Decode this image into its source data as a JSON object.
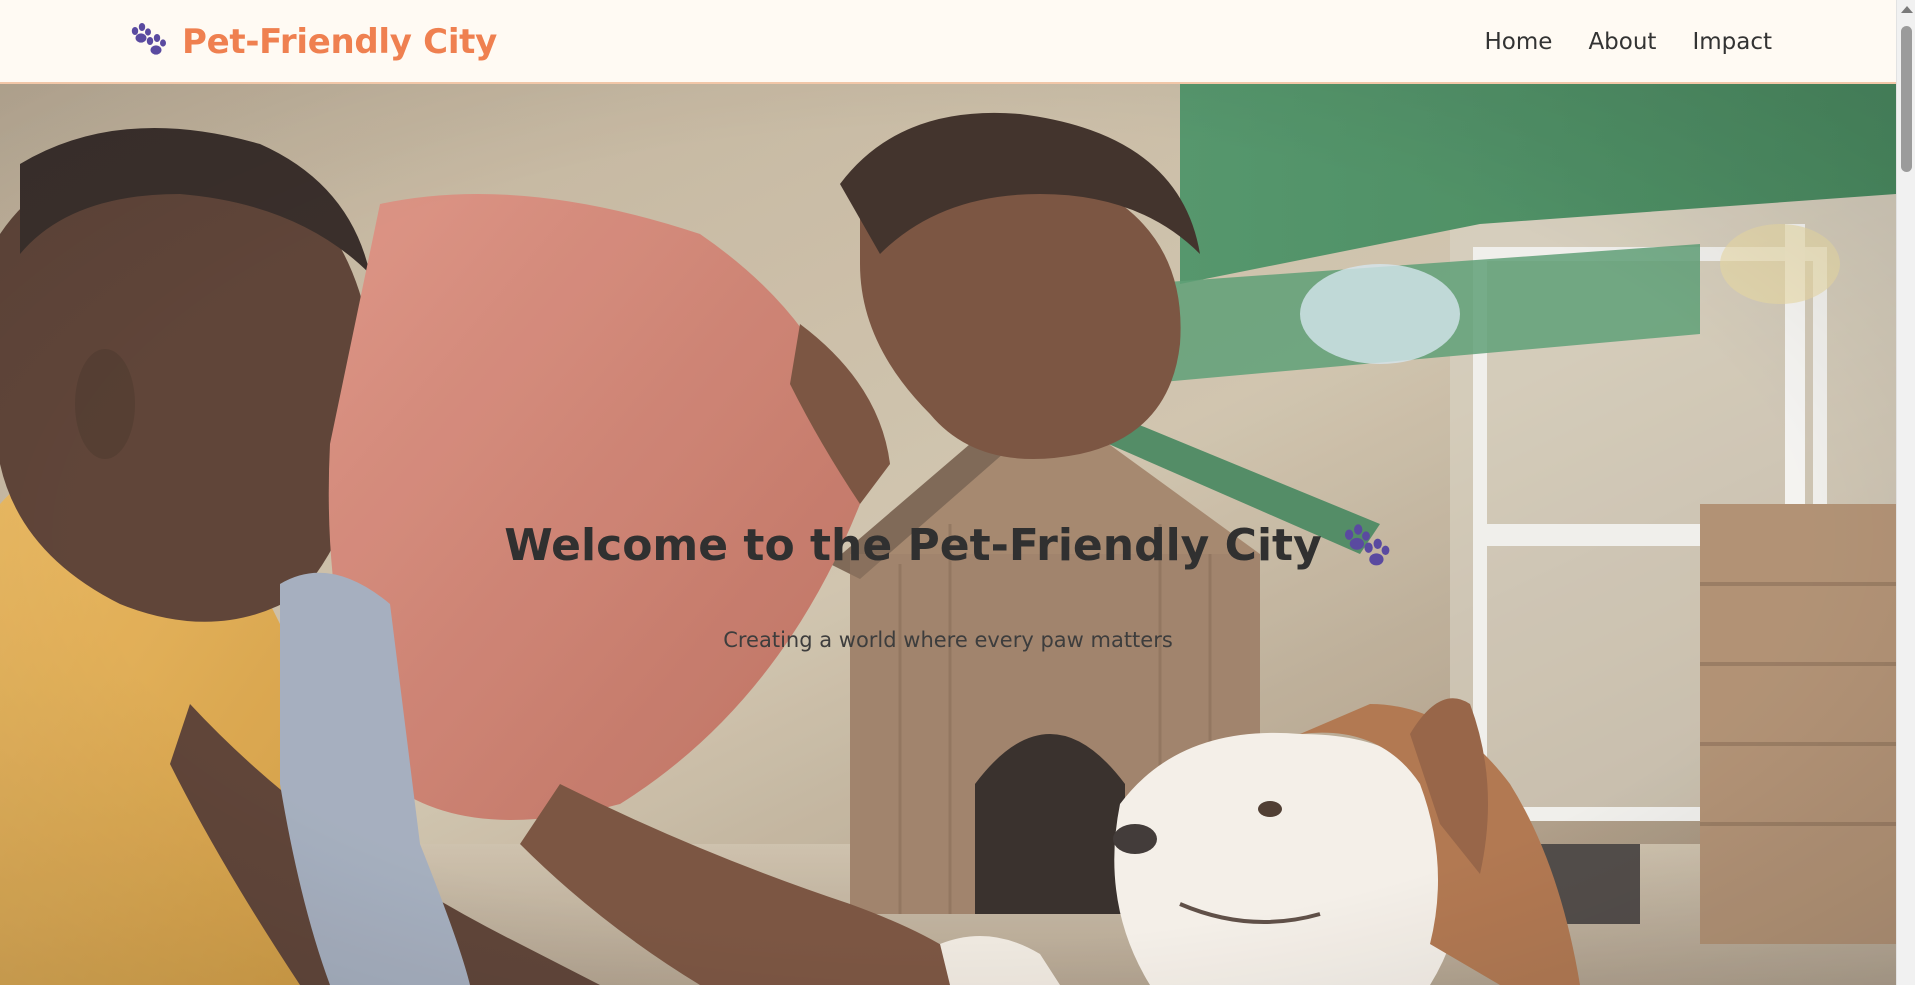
{
  "header": {
    "brand_icon": "paw-icon",
    "brand_text": "Pet-Friendly City",
    "nav": [
      {
        "label": "Home"
      },
      {
        "label": "About"
      },
      {
        "label": "Impact"
      }
    ]
  },
  "hero": {
    "title": "Welcome to the Pet-Friendly City",
    "title_icon": "paw-icon",
    "subtitle": "Creating a world where every paw matters",
    "image": "photo of a man, a woman in a pink shirt shaking paws with a brown and white dog in front of a wooden dog house"
  },
  "colors": {
    "brand": "#ef8050",
    "paw": "#5a4aa0",
    "background": "#fffaf3",
    "nav_text": "#333333"
  }
}
